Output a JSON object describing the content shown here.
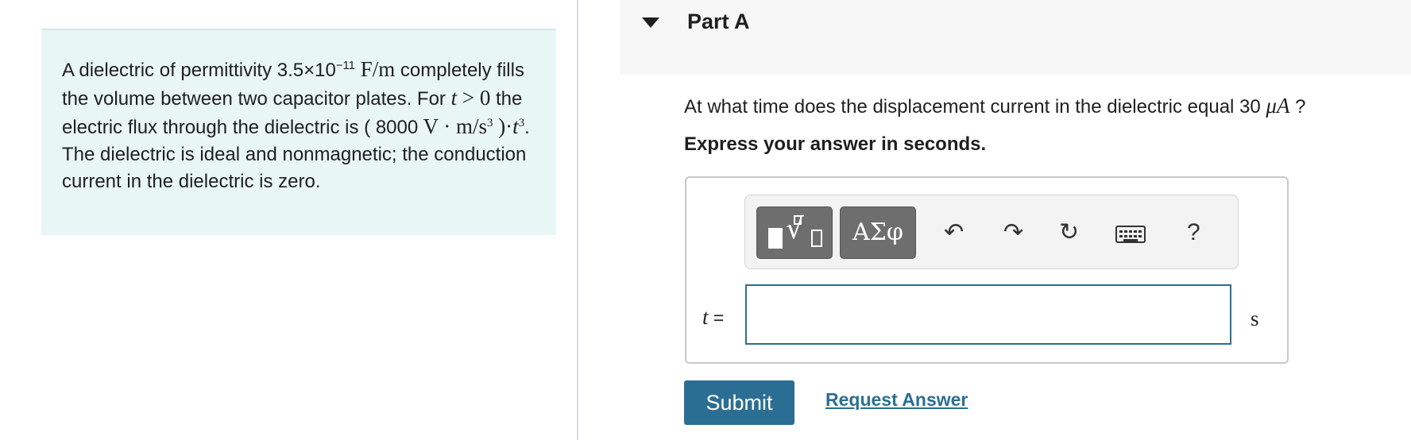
{
  "problem": {
    "t1": "A dielectric of permittivity 3.5×10",
    "t1_exp": "−11",
    "t1_unit": " F/m",
    "t2": " completely fills the volume between two capacitor plates. For ",
    "t2_var": "t",
    "t2_rel": " > 0",
    "t3": " the electric flux through the dielectric is ( ",
    "t3_val": "8000",
    "t3_unit": " V · m/s",
    "t3_unit_exp": "3",
    "t3_close": " )·",
    "t3_var": "t",
    "t3_var_exp": "3",
    "t4": ". The dielectric is ideal and nonmagnetic; the conduction current in the dielectric is zero."
  },
  "part": {
    "title": "Part A"
  },
  "question": {
    "text": "At what time does the displacement current in the dielectric equal 30 ",
    "unit": "μA",
    "end": " ?"
  },
  "instruction": "Express your answer in seconds.",
  "toolbar": {
    "greek_label": "ΑΣφ",
    "help_label": "?"
  },
  "answer": {
    "variable": "t",
    "equals": " =",
    "value": "",
    "unit": "s"
  },
  "actions": {
    "submit_label": "Submit",
    "request_label": "Request Answer"
  }
}
